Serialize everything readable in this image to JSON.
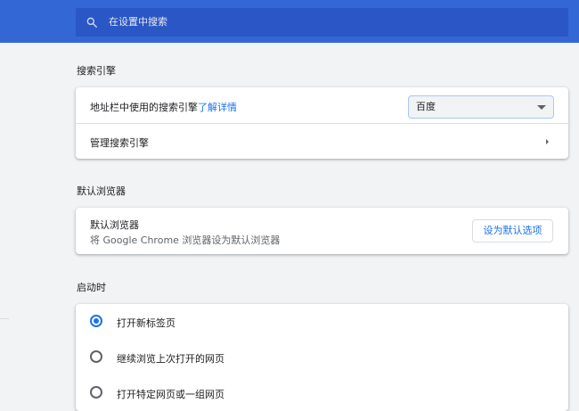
{
  "search": {
    "placeholder": "在设置中搜索"
  },
  "search_engine": {
    "title": "搜索引擎",
    "address_bar_label": "地址栏中使用的搜索引擎",
    "learn_more": "了解详情",
    "selected_engine": "百度",
    "manage_label": "管理搜索引擎"
  },
  "default_browser": {
    "title": "默认浏览器",
    "label": "默认浏览器",
    "description": "将 Google Chrome 浏览器设为默认浏览器",
    "button": "设为默认选项"
  },
  "startup": {
    "title": "启动时",
    "options": [
      {
        "label": "打开新标签页",
        "checked": true
      },
      {
        "label": "继续浏览上次打开的网页",
        "checked": false
      },
      {
        "label": "打开特定网页或一组网页",
        "checked": false
      }
    ]
  },
  "colors": {
    "header": "#3367d6",
    "accent": "#1a73e8"
  }
}
